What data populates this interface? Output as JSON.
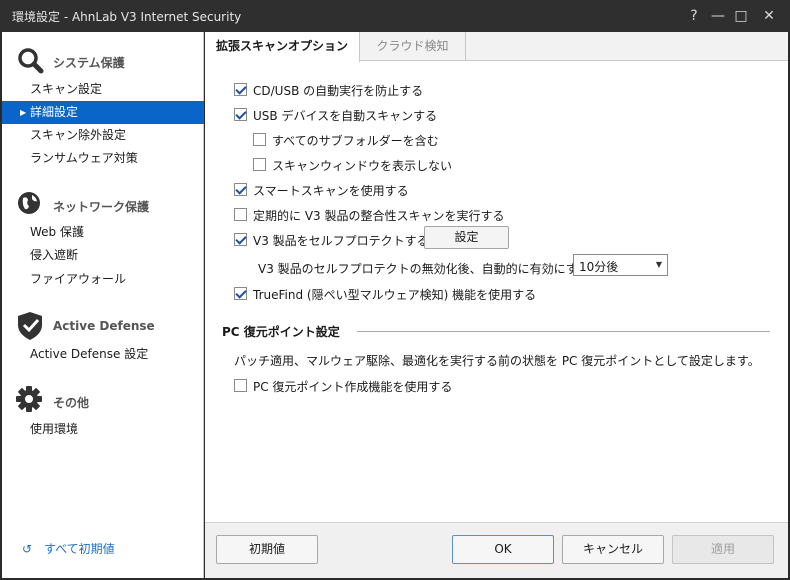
{
  "window": {
    "title": "環境設定 - AhnLab V3 Internet Security",
    "help": "?",
    "minimize": "—",
    "maximize": "□",
    "close": "✕"
  },
  "sidebar": {
    "categories": [
      {
        "label": "システム保護",
        "icon": "magnifier-icon",
        "items": [
          "スキャン設定",
          "詳細設定",
          "スキャン除外設定",
          "ランサムウェア対策"
        ]
      },
      {
        "label": "ネットワーク保護",
        "icon": "globe-icon",
        "items": [
          "Web 保護",
          "侵入遮断",
          "ファイアウォール"
        ]
      },
      {
        "label": "Active Defense",
        "icon": "shield-icon",
        "items": [
          "Active Defense 設定"
        ]
      },
      {
        "label": "その他",
        "icon": "gear-icon",
        "items": [
          "使用環境"
        ]
      }
    ],
    "active_item": "詳細設定",
    "reset_all": "すべて初期値"
  },
  "tabs": [
    "拡張スキャンオプション",
    "クラウド検知"
  ],
  "options": {
    "block_autorun": {
      "label": "CD/USB の自動実行を防止する",
      "checked": true
    },
    "usb_autoscan": {
      "label": "USB デバイスを自動スキャンする",
      "checked": true
    },
    "include_subfolders": {
      "label": "すべてのサブフォルダーを含む",
      "checked": false
    },
    "hide_scan_window": {
      "label": "スキャンウィンドウを表示しない",
      "checked": false
    },
    "smart_scan": {
      "label": "スマートスキャンを使用する",
      "checked": true
    },
    "integrity_scan": {
      "label": "定期的に V3 製品の整合性スキャンを実行する",
      "checked": false
    },
    "self_protect": {
      "label": "V3 製品をセルフプロテクトする",
      "checked": true
    },
    "self_protect_button": "設定",
    "reenable_label": "V3 製品のセルフプロテクトの無効化後、自動的に有効にする",
    "reenable_value": "10分後",
    "truefind": {
      "label": "TrueFind (隠ぺい型マルウェア検知) 機能を使用する",
      "checked": true
    }
  },
  "restore_point": {
    "title": "PC 復元ポイント設定",
    "description": "パッチ適用、マルウェア駆除、最適化を実行する前の状態を PC 復元ポイントとして設定します。",
    "option": {
      "label": "PC 復元ポイント作成機能を使用する",
      "checked": false
    }
  },
  "footer": {
    "defaults": "初期値",
    "ok": "OK",
    "cancel": "キャンセル",
    "apply": "適用"
  }
}
